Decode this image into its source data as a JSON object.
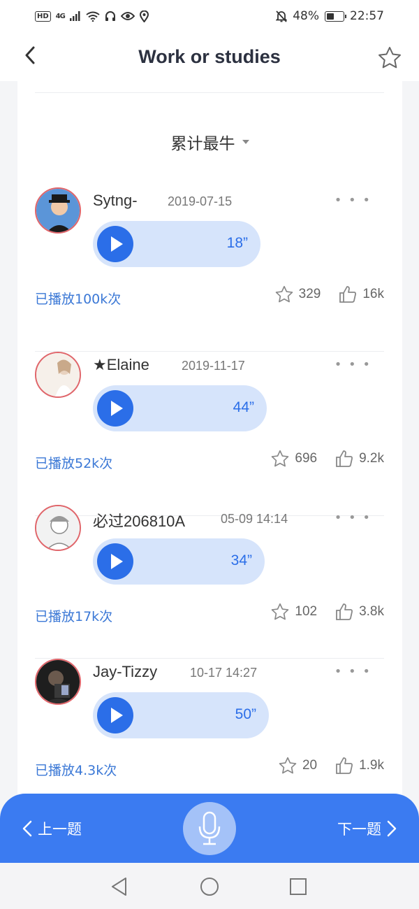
{
  "status_bar": {
    "hd": "HD",
    "network": "4G",
    "battery": "48%",
    "battery_level": 0.48,
    "time": "22:57"
  },
  "header": {
    "title": "Work or studies",
    "back_icon": "chevron-left-icon",
    "favorite_icon": "star-outline-icon"
  },
  "sort": {
    "label": "累计最牛"
  },
  "answers": [
    {
      "user": "Sytng-",
      "date": "2019-07-15",
      "duration": "18”",
      "plays": "已播放100k次",
      "favorites": "329",
      "likes": "16k",
      "avatar_color": "#3a7bd5"
    },
    {
      "user": "★Elaine",
      "date": "2019-11-17",
      "duration": "44”",
      "plays": "已播放52k次",
      "favorites": "696",
      "likes": "9.2k",
      "avatar_color": "#f3ece6"
    },
    {
      "user": "必过206810A",
      "date": "05-09 14:14",
      "duration": "34”",
      "plays": "已播放17k次",
      "favorites": "102",
      "likes": "3.8k",
      "avatar_color": "#f0f0f0"
    },
    {
      "user": "Jay-Tizzy",
      "date": "10-17 14:27",
      "duration": "50”",
      "plays": "已播放4.3k次",
      "favorites": "20",
      "likes": "1.9k",
      "avatar_color": "#222222"
    }
  ],
  "action_bar": {
    "prev_label": "上一题",
    "next_label": "下一题",
    "accent": "#3b7bf1"
  }
}
